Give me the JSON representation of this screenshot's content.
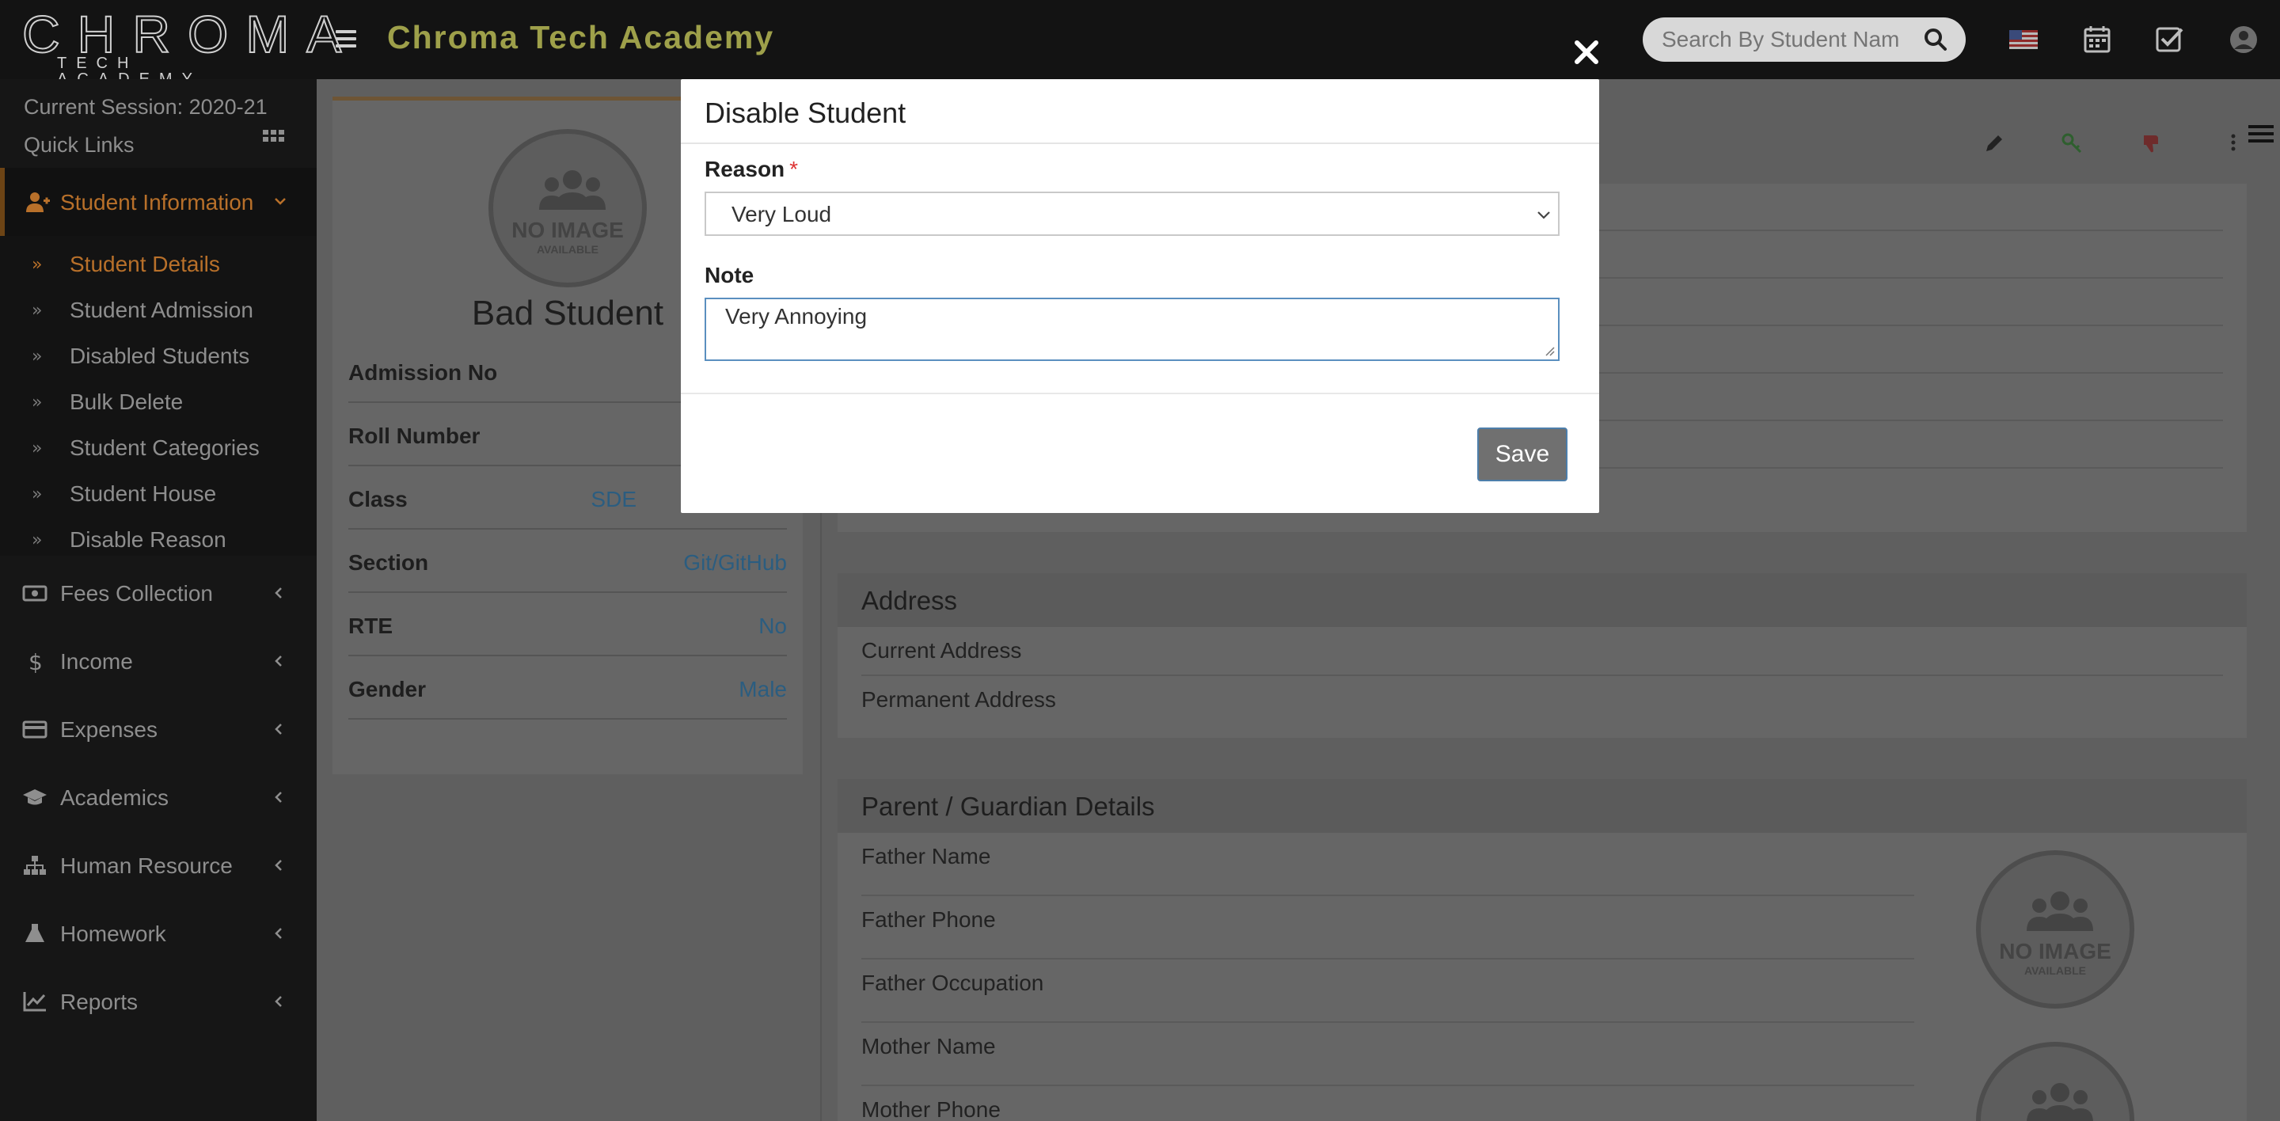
{
  "header": {
    "logo_main": "CHROMA",
    "logo_sub": "TECH ACADEMY",
    "app_title": "Chroma Tech Academy",
    "search_placeholder": "Search By Student Name",
    "icons": [
      "menu-icon",
      "search-icon",
      "us-flag-icon",
      "calendar-icon",
      "tasks-checkbox-icon",
      "user-avatar-icon"
    ]
  },
  "sidebar": {
    "session": "Current Session: 2020-21",
    "quick_links": "Quick Links",
    "active_section": "Student Information",
    "sub_items": [
      {
        "label": "Student Details",
        "active": true
      },
      {
        "label": "Student Admission"
      },
      {
        "label": "Disabled Students"
      },
      {
        "label": "Bulk Delete"
      },
      {
        "label": "Student Categories"
      },
      {
        "label": "Student House"
      },
      {
        "label": "Disable Reason"
      }
    ],
    "nav_items": [
      {
        "label": "Fees Collection",
        "icon": "money-icon"
      },
      {
        "label": "Income",
        "icon": "dollar-icon"
      },
      {
        "label": "Expenses",
        "icon": "credit-card-icon"
      },
      {
        "label": "Academics",
        "icon": "graduation-cap-icon"
      },
      {
        "label": "Human Resource",
        "icon": "sitemap-icon"
      },
      {
        "label": "Homework",
        "icon": "flask-icon"
      },
      {
        "label": "Reports",
        "icon": "line-chart-icon"
      }
    ]
  },
  "profile": {
    "no_image": "NO IMAGE",
    "available": "AVAILABLE",
    "name": "Bad Student",
    "rows": [
      {
        "key": "Admission No",
        "value": ""
      },
      {
        "key": "Roll Number",
        "value": ""
      },
      {
        "key": "Class",
        "value": "SDE"
      },
      {
        "key": "Section",
        "value": "Git/GitHub"
      },
      {
        "key": "RTE",
        "value": "No"
      },
      {
        "key": "Gender",
        "value": "Male"
      }
    ]
  },
  "details": {
    "address_title": "Address",
    "address_rows": [
      "Current Address",
      "Permanent Address"
    ],
    "parent_title": "Parent / Guardian Details",
    "parent_rows": [
      "Father Name",
      "Father Phone",
      "Father Occupation",
      "Mother Name",
      "Mother Phone"
    ],
    "toolbar_icons": [
      "edit-pencil-icon",
      "key-icon",
      "thumbs-down-icon",
      "more-vertical-icon"
    ]
  },
  "modal": {
    "title": "Disable Student",
    "reason_label": "Reason",
    "required_mark": "*",
    "reason_value": "Very Loud",
    "note_label": "Note",
    "note_value": "Very Annoying",
    "save_label": "Save"
  },
  "colors": {
    "header_bg": "#131313",
    "sidebar_bg": "#161616",
    "accent_orange": "#b8702a",
    "title_olive": "#9ea04a",
    "link_blue": "#2b5d80",
    "overlay_gray": "#5f5f5f",
    "save_button": "#707070"
  }
}
